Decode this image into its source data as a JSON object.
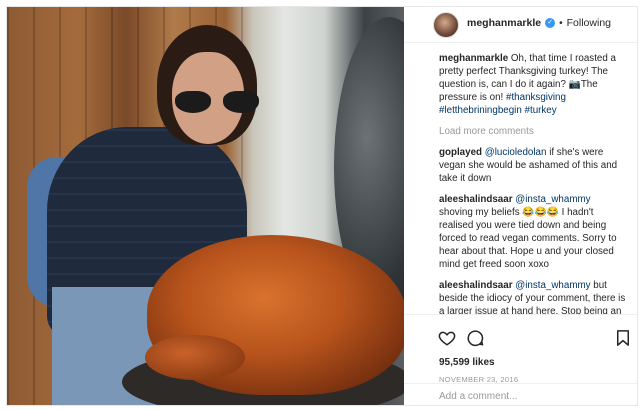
{
  "header": {
    "username": "meghanmarkle",
    "verified_icon": "verified-badge-icon",
    "separator": "•",
    "follow_status": "Following"
  },
  "caption": {
    "username": "meghanmarkle",
    "text": "Oh, that time I roasted a pretty perfect Thanksgiving turkey! The question is, can I do it again? 📷The pressure is on!",
    "hashtags": [
      "#thanksgiving",
      "#letthebriningbegin",
      "#turkey"
    ]
  },
  "load_more": "Load more comments",
  "comments": [
    {
      "username": "goplayed",
      "mention": "@lucioledolan",
      "text": "if she's were vegan she would be ashamed of this and take it down"
    },
    {
      "username": "aleeshalindsaar",
      "mention": "@insta_whammy",
      "text": "shoving my beliefs 😂😂😂 I hadn't realised you were tied down and being forced to read vegan comments. Sorry to hear about that. Hope u and your closed mind get freed soon xoxo"
    },
    {
      "username": "aleeshalindsaar",
      "mention": "@insta_whammy",
      "text": "but beside the idiocy of your comment, there is a larger issue at hand here. Stop being an online troll who is against such a positive"
    }
  ],
  "actions": {
    "like_icon": "heart-icon",
    "comment_icon": "comment-icon",
    "save_icon": "bookmark-icon"
  },
  "likes": "95,599 likes",
  "date": "NOVEMBER 23, 2016",
  "comment_placeholder": "Add a comment..."
}
